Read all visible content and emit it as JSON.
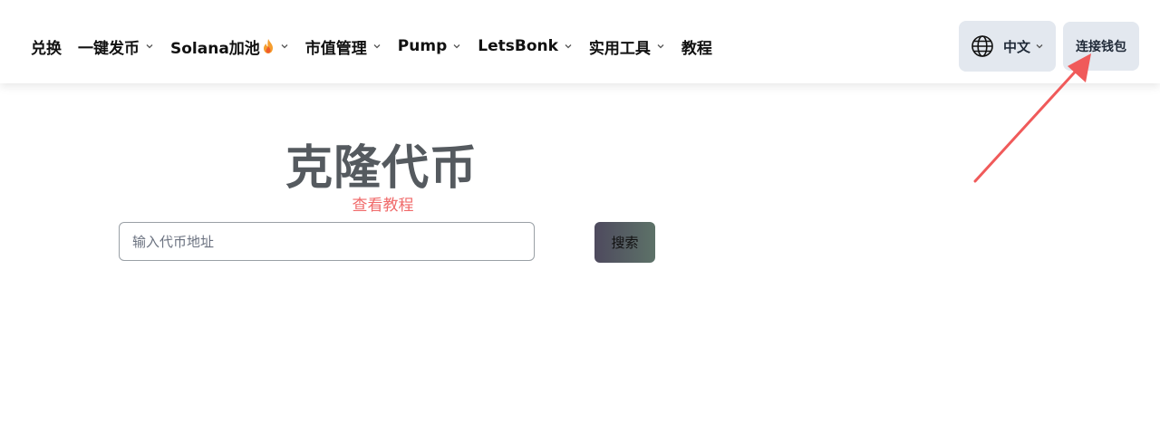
{
  "navbar": {
    "items": [
      {
        "label": "兑换",
        "has_dropdown": false
      },
      {
        "label": "一键发币",
        "has_dropdown": true
      },
      {
        "label": "Solana加池",
        "has_dropdown": true,
        "icon": "flame-icon"
      },
      {
        "label": "市值管理",
        "has_dropdown": true
      },
      {
        "label": "Pump",
        "has_dropdown": true
      },
      {
        "label": "LetsBonk",
        "has_dropdown": true
      },
      {
        "label": "实用工具",
        "has_dropdown": true
      },
      {
        "label": "教程",
        "has_dropdown": false
      }
    ],
    "language": {
      "label": "中文",
      "icon": "globe-icon"
    },
    "wallet_button": "连接钱包"
  },
  "main": {
    "title": "克隆代币",
    "tutorial_link": "查看教程",
    "search": {
      "placeholder": "输入代币地址",
      "value": "",
      "button_label": "搜索"
    }
  },
  "colors": {
    "title": "#555a5f",
    "link": "#f06a6a",
    "button_bg": "#e3e8ef",
    "annotation_arrow": "#f05a5a"
  }
}
